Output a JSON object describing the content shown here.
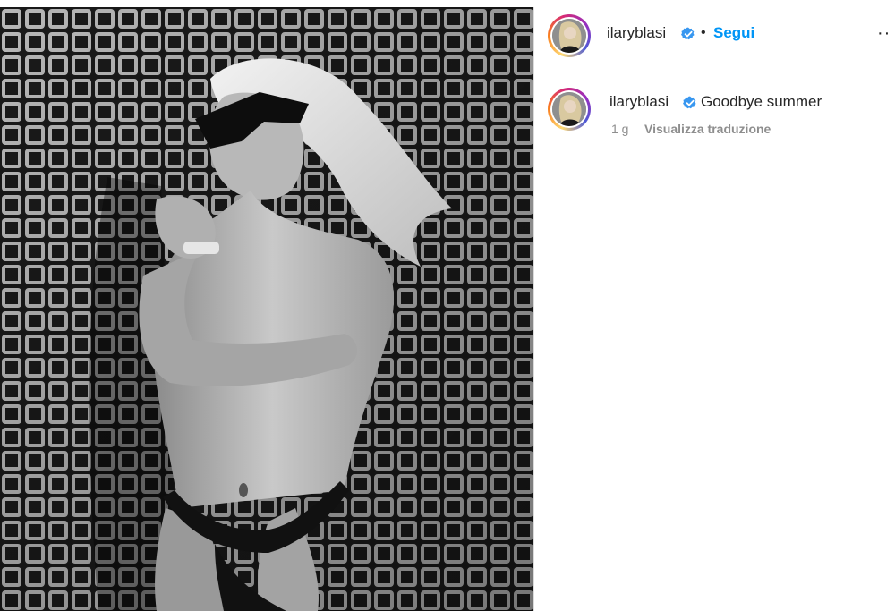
{
  "post": {
    "author": "ilaryblasi",
    "verified": true,
    "separator": "•",
    "follow_label": "Segui",
    "more_label": "··",
    "image_alt": "black and white photo of woman in sunglasses against a grid fence"
  },
  "caption": {
    "author": "ilaryblasi",
    "text": "Goodbye summer",
    "time": "1 g",
    "translate_label": "Visualizza traduzione"
  },
  "colors": {
    "link": "#0095f6",
    "text": "#262626",
    "muted": "#8e8e8e",
    "verified": "#3897f0"
  },
  "icons": {
    "verified": "verified-badge-icon",
    "more": "more-options-icon"
  }
}
